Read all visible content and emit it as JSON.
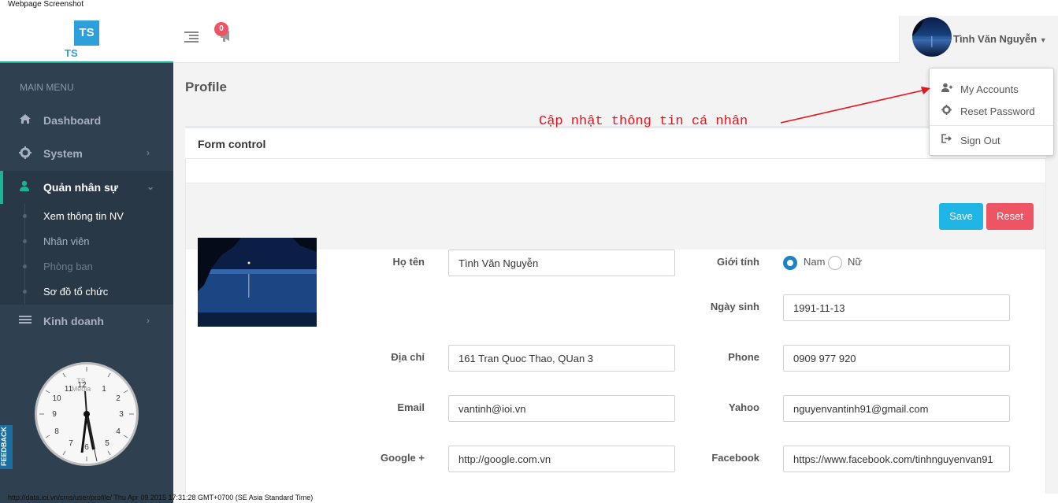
{
  "caption": {
    "top": "Webpage Screenshot",
    "bottom": "http://data.ioi.vn/cms/user/profile/ Thu Apr 09 2015 17:31:28 GMT+0700 (SE Asia Standard Time)"
  },
  "brand": {
    "mark": "TS",
    "sub": "TS"
  },
  "header": {
    "notification_count": "0",
    "user_name": "Tình Văn Nguyễn"
  },
  "user_menu": {
    "items": [
      {
        "label": "My Accounts",
        "icon": "user-plus-icon"
      },
      {
        "label": "Reset Password",
        "icon": "gear-icon"
      },
      {
        "label": "Sign Out",
        "icon": "sign-out-icon"
      }
    ]
  },
  "sidebar": {
    "title": "MAIN MENU",
    "items": [
      {
        "label": "Dashboard",
        "icon": "home-icon"
      },
      {
        "label": "System",
        "icon": "cog-icon"
      },
      {
        "label": "Quản nhân sự",
        "icon": "user-icon"
      },
      {
        "label": "Kinh doanh",
        "icon": "list-icon"
      }
    ],
    "sub_items": [
      {
        "label": "Xem thông tin NV"
      },
      {
        "label": "Nhân viên"
      },
      {
        "label": "Phòng ban"
      },
      {
        "label": "Sơ đồ tổ chức"
      }
    ],
    "feedback": "FEEDBACK"
  },
  "clock": {
    "brand": "TS Media",
    "numbers": [
      "12",
      "1",
      "2",
      "3",
      "4",
      "5",
      "6",
      "7",
      "8",
      "9",
      "10",
      "11"
    ],
    "time": "17:31"
  },
  "page": {
    "title": "Profile",
    "card_title": "Form control",
    "save_label": "Save",
    "reset_label": "Reset"
  },
  "form": {
    "ho_ten_label": "Họ tên",
    "ho_ten_value": "Tình Văn Nguyễn",
    "gioi_tinh_label": "Giới tính",
    "gender_options": [
      "Nam",
      "Nữ"
    ],
    "gender_selected": "Nam",
    "ngay_sinh_label": "Ngày sinh",
    "ngay_sinh_value": "1991-11-13",
    "dia_chi_label": "Địa chỉ",
    "dia_chi_value": "161 Tran Quoc Thao, QUan 3",
    "phone_label": "Phone",
    "phone_value": "0909 977 920",
    "email_label": "Email",
    "email_value": "vantinh@ioi.vn",
    "yahoo_label": "Yahoo",
    "yahoo_value": "nguyenvantinh91@gmail.com",
    "google_label": "Google +",
    "google_value": "http://google.com.vn",
    "facebook_label": "Facebook",
    "facebook_value": "https://www.facebook.com/tinhnguyenvan91"
  },
  "annotation": "Cập nhật thông tin cá nhân",
  "colors": {
    "sidebar_bg": "#2f4050",
    "accent": "#1ab394",
    "save_button": "#1fb5e5",
    "reset_button": "#ed5565",
    "annotation": "#e8131a"
  }
}
